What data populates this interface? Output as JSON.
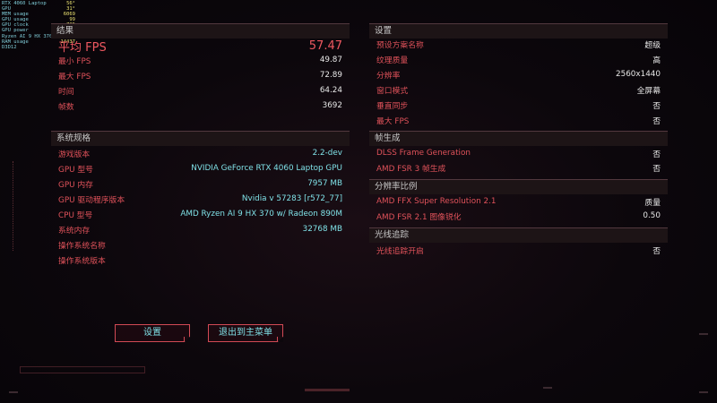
{
  "overlay": [
    {
      "label": "RTX 4060 Laptop",
      "value": "56°"
    },
    {
      "label": "GPU",
      "value": "31°"
    },
    {
      "label": "MEM usage",
      "value": "6069"
    },
    {
      "label": "GPU usage",
      "value": "99"
    },
    {
      "label": "GPU clock",
      "value": "735"
    },
    {
      "label": "GPU power",
      "value": ""
    },
    {
      "label": "Ryzen AI 9 HX 370",
      "value": ""
    },
    {
      "label": "RAM usage",
      "value": "14437"
    },
    {
      "label": "D3D12",
      "value": ""
    }
  ],
  "results": {
    "header": "结果",
    "avg_label": "平均 FPS",
    "avg_value": "57.47",
    "rows": [
      {
        "label": "最小 FPS",
        "value": "49.87"
      },
      {
        "label": "最大 FPS",
        "value": "72.89"
      },
      {
        "label": "时间",
        "value": "64.24"
      },
      {
        "label": "帧数",
        "value": "3692"
      }
    ]
  },
  "system": {
    "header": "系统规格",
    "rows": [
      {
        "label": "游戏版本",
        "value": "2.2-dev"
      },
      {
        "label": "GPU 型号",
        "value": "NVIDIA GeForce RTX 4060 Laptop GPU"
      },
      {
        "label": "GPU 内存",
        "value": "7957 MB"
      },
      {
        "label": "GPU 驱动程序版本",
        "value": "Nvidia v 57283 [r572_77]"
      },
      {
        "label": "CPU 型号",
        "value": "AMD Ryzen AI 9 HX 370 w/ Radeon 890M"
      },
      {
        "label": "系统内存",
        "value": "32768 MB"
      },
      {
        "label": "操作系统名称",
        "value": ""
      },
      {
        "label": "操作系统版本",
        "value": ""
      }
    ]
  },
  "settings": {
    "header": "设置",
    "rows": [
      {
        "label": "预设方案名称",
        "value": "超级"
      },
      {
        "label": "纹理质量",
        "value": "高"
      },
      {
        "label": "分辨率",
        "value": "2560x1440"
      },
      {
        "label": "窗口模式",
        "value": "全屏幕"
      },
      {
        "label": "垂直同步",
        "value": "否"
      },
      {
        "label": "最大 FPS",
        "value": "否"
      }
    ]
  },
  "framegen": {
    "header": "帧生成",
    "rows": [
      {
        "label": "DLSS Frame Generation",
        "value": "否"
      },
      {
        "label": "AMD FSR 3 帧生成",
        "value": "否"
      }
    ]
  },
  "scaling": {
    "header": "分辨率比例",
    "rows": [
      {
        "label": "AMD FFX Super Resolution 2.1",
        "value": "质量"
      },
      {
        "label": "AMD FSR 2.1 图像锐化",
        "value": "0.50"
      }
    ]
  },
  "raytracing": {
    "header": "光线追踪",
    "rows": [
      {
        "label": "光线追踪开启",
        "value": "否"
      }
    ]
  },
  "buttons": {
    "settings": "设置",
    "exit": "退出到主菜单"
  },
  "colors": {
    "accent_red": "#e0525a",
    "accent_cyan": "#7fe0e6"
  }
}
